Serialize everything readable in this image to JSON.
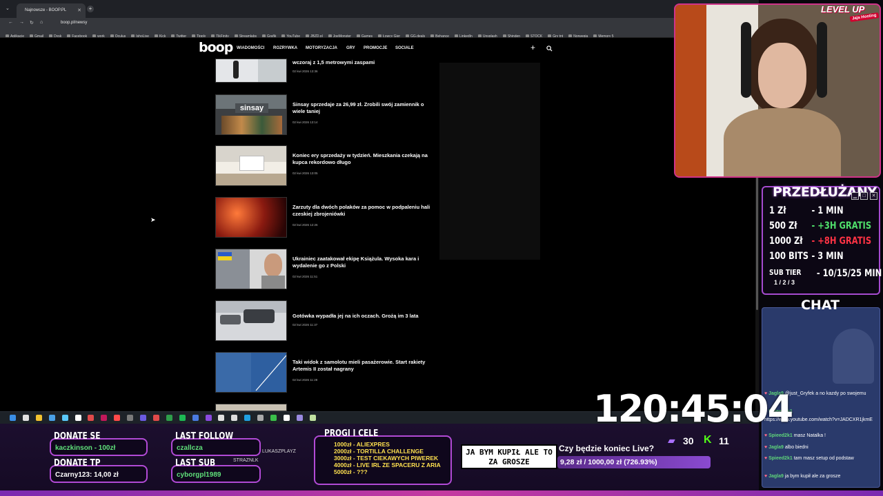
{
  "browser": {
    "tab_title": "Najnowsze - BOOP.PL",
    "url": "boop.pl/newsy",
    "bookmarks": [
      "Aplikacje",
      "Gmail",
      "Dysk",
      "Facebook",
      "work",
      "Oculus",
      "IshoLive",
      "Kick",
      "Twitter",
      "Tipply",
      "TikFinity",
      "Streamlabs",
      "Grafik",
      "YouTube",
      "JBZD.pl",
      "JoeMonster",
      "Games",
      "Łowcy Gier",
      "GG.deals",
      "Behance",
      "LinkedIn",
      "Unsplash",
      "Shinden",
      "STOCK",
      "Gry tnt",
      "Norwegia",
      "Memory 5"
    ]
  },
  "site": {
    "logo": "boop",
    "nav": [
      "WIADOMOŚCI",
      "ROZRYWKA",
      "MOTORYZACJA",
      "GRY",
      "PROMOCJE",
      "SOCIALE"
    ],
    "articles": [
      {
        "title": "wczoraj z 1,5 metrowymi zaspami",
        "date": "02 kwi 2026 13:36"
      },
      {
        "title": "Sinsay sprzedaje za 26,99 zł. Zrobili swój zamiennik o wiele taniej",
        "date": "02 kwi 2026 13:14",
        "thumb_text": "sinsay"
      },
      {
        "title": "Koniec ery sprzedaży w tydzień. Mieszkania czekają na kupca rekordowo długo",
        "date": "02 kwi 2026 13:05"
      },
      {
        "title": "Zarzuty dla dwóch polaków za pomoc w podpaleniu hali czeskiej zbrojeniówki",
        "date": "02 kwi 2026 12:26"
      },
      {
        "title": "Ukrainiec zaatakował ekipę Książula. Wysoka kara i wydalenie go z Polski",
        "date": "02 kwi 2026 11:51"
      },
      {
        "title": "Gotówka wypadła jej na ich oczach. Grożą im 3 lata",
        "date": "02 kwi 2026 11:37"
      },
      {
        "title": "Taki widok z samolotu mieli pasażerowie. Start rakiety Artemis II został nagrany",
        "date": "02 kwi 2026 11:28"
      }
    ]
  },
  "webcam": {
    "brand": "LEVEL UP",
    "brand_badge": "Jaja Hosting"
  },
  "extension": {
    "title": "PRZEDŁUŻANY",
    "rows": [
      {
        "left": "1 Zł",
        "right": "- 1 MIN",
        "color": "white"
      },
      {
        "left": "500 Zł",
        "right": "- +3H GRATIS",
        "color": "green"
      },
      {
        "left": "1000 Zł",
        "right": "- +8H GRATIS",
        "color": "red"
      },
      {
        "left": "100 BITS",
        "right": "- 3 MIN",
        "color": "white"
      },
      {
        "left": "SUB TIER",
        "right": "- 10/15/25 MIN",
        "color": "white"
      }
    ],
    "sub_tier_levels": "1 / 2 / 3"
  },
  "chat": {
    "label": "CHAT",
    "messages": [
      {
        "user": "Jagla9",
        "text": "@just_Gryfek a no kazdy po swojemu"
      },
      {
        "user": "Spieed2k1",
        "text": ""
      },
      {
        "user": "",
        "text": "https://www.youtube.com/watch?v=JADCXR1jkmE"
      },
      {
        "user": "Spieed2k1",
        "text": "masz Natalka !"
      },
      {
        "user": "Jagla9",
        "text": "albo biedni"
      },
      {
        "user": "Spieed2k1",
        "text": "tam masz setup od podstaw"
      },
      {
        "user": "Jagla9",
        "text": "ja bym kupił ale za grosze"
      }
    ]
  },
  "timer": "120:45:04",
  "overlay": {
    "donate_se_label": "DONATE SE",
    "donate_se_value": "kaczkinson - 100zł",
    "donate_tp_label": "DONATE TP",
    "donate_tp_value": "Czarny123: 14,00 zł",
    "last_follow_label": "LAST FOLLOW",
    "last_follow_value": "czallcza",
    "last_sub_label": "LAST SUB",
    "last_sub_value": "cyborgpl1989",
    "floating_names": [
      "LUKASZPLAYZ",
      "STRAZNLK"
    ],
    "goals_label": "PROGI I CELE",
    "goals": [
      "1000zł - ALIEXPRES",
      "2000zł - TORTILLA CHALLENGE",
      "3000zł - TEST CIEKAWYCH PIWEREK",
      "4000zł - LIVE IRL ZE SPACERU Z ARIA",
      "5000zł - ???"
    ],
    "pinned_message": "JA BYM KUPIŁ ALE TO ZA GROSZE",
    "goal_question": "Czy będzie koniec Live?",
    "goal_progress": "9,28 zł / 1000,00 zł (726.93%)",
    "goal_percent": 726.93,
    "twitch_viewers": "30",
    "kick_viewers": "11",
    "accent": "#b24ad6"
  }
}
